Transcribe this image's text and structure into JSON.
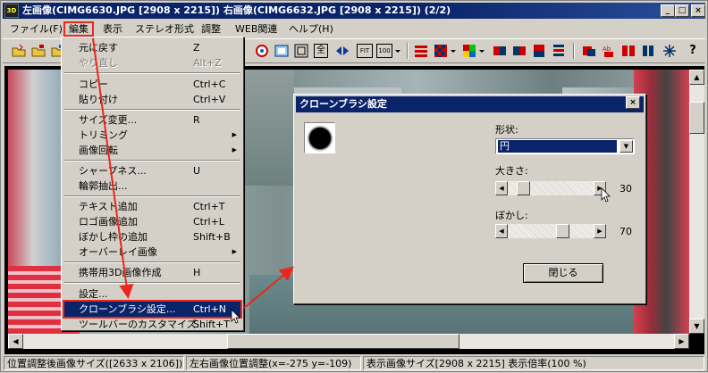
{
  "titlebar": {
    "icon_text": "3D",
    "title": "左画像(CIMG6630.JPG [2908 x 2215]) 右画像(CIMG6632.JPG [2908 x 2215])  (2/2)",
    "min_label": "_",
    "max_label": "□",
    "close_label": "×"
  },
  "menubar": {
    "items": [
      {
        "label": "ファイル(F)"
      },
      {
        "label": "編集"
      },
      {
        "label": "表示"
      },
      {
        "label": "ステレオ形式"
      },
      {
        "label": "調整"
      },
      {
        "label": "WEB関連"
      },
      {
        "label": "ヘルプ(H)"
      }
    ]
  },
  "toolbar": {
    "fit_label": "FIT",
    "zoom100_label": "100",
    "zen_label": "全",
    "help_label": "?"
  },
  "edit_menu": {
    "items": [
      {
        "label": "元に戻す",
        "key": "Z",
        "disabled": false
      },
      {
        "label": "やり直し",
        "key": "Alt+Z",
        "disabled": true
      },
      {
        "label": "コピー",
        "key": "Ctrl+C"
      },
      {
        "label": "貼り付け",
        "key": "Ctrl+V"
      },
      {
        "label": "サイズ変更...",
        "key": "R"
      },
      {
        "label": "トリミング",
        "key": ""
      },
      {
        "label": "画像回転",
        "key": ""
      },
      {
        "label": "シャープネス...",
        "key": "U"
      },
      {
        "label": "輪郭抽出...",
        "key": ""
      },
      {
        "label": "テキスト追加",
        "key": "Ctrl+T"
      },
      {
        "label": "ロゴ画像追加",
        "key": "Ctrl+L"
      },
      {
        "label": "ぼかし枠の追加",
        "key": "Shift+B"
      },
      {
        "label": "オーバーレイ画像",
        "key": ""
      },
      {
        "label": "携帯用3D画像作成",
        "key": "H"
      },
      {
        "label": "設定...",
        "key": ""
      },
      {
        "label": "クローンブラシ設定...",
        "key": "Ctrl+N"
      },
      {
        "label": "ツールバーのカスタマイズ...",
        "key": "Shift+T"
      }
    ]
  },
  "dialog": {
    "title": "クローンブラシ設定",
    "close_label": "×",
    "shape_label": "形状:",
    "shape_value": "円",
    "size_label": "大きさ:",
    "size_value": "30",
    "blur_label": "ぼかし:",
    "blur_value": "70",
    "close_button": "閉じる"
  },
  "statusbar": {
    "panels": [
      "位置調整後画像サイズ([2633 x 2106])",
      "左右画像位置調整(x=-275 y=-109)",
      "表示画像サイズ[2908 x 2215]  表示倍率(100 %)"
    ]
  },
  "colors": {
    "titlebar": "#0a246a",
    "annotation_red": "#e8281c",
    "face": "#d4d0c8"
  }
}
